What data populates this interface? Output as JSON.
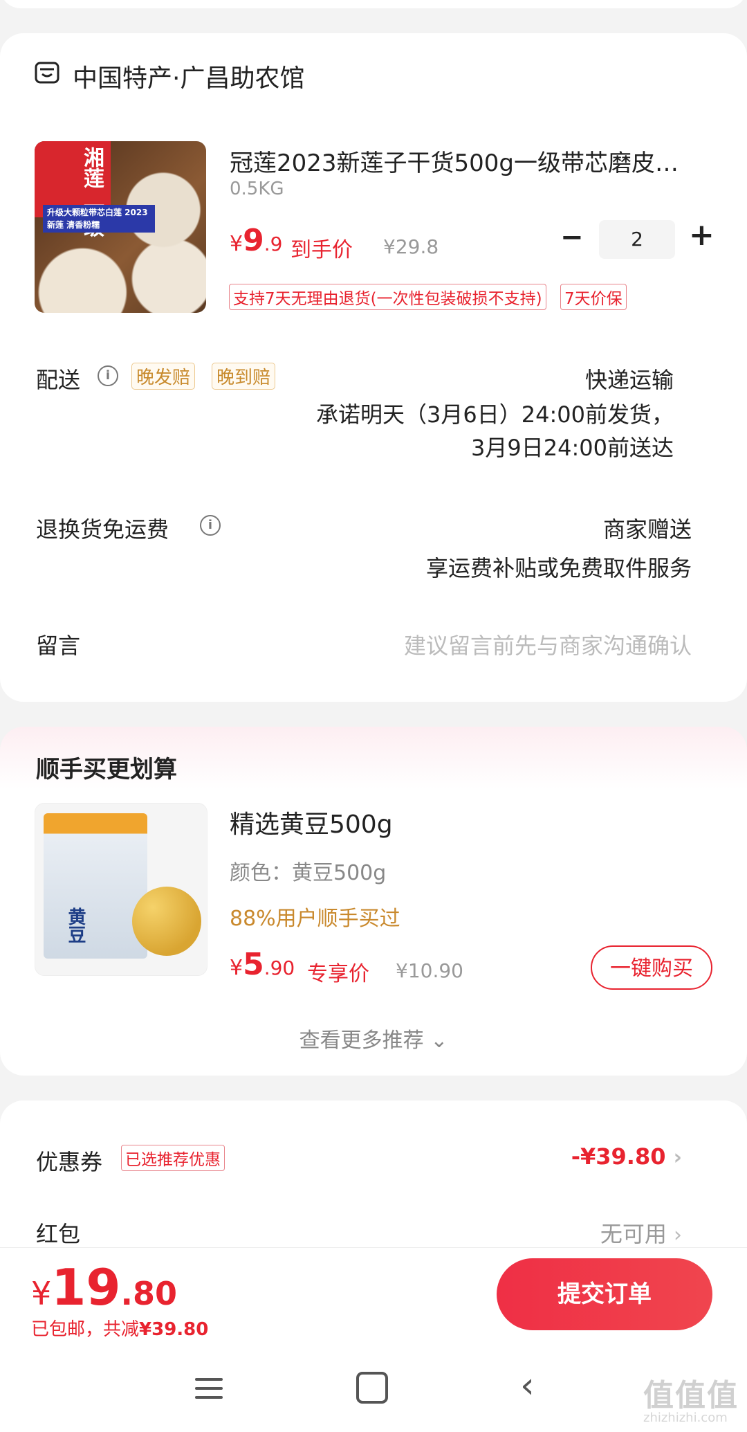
{
  "store": {
    "name": "中国特产·广昌助农馆"
  },
  "product": {
    "name": "冠莲2023新莲子干货500g一级带芯磨皮…",
    "spec": "0.5KG",
    "price_currency": "¥",
    "price_int": "9",
    "price_dec": ".9",
    "price_label": "到手价",
    "original_price": "¥29.8",
    "quantity": "2",
    "image_badge": "湘莲 一级",
    "image_band": "升级大颗粒带芯白莲 2023新莲 清香粉糯",
    "tags": [
      "支持7天无理由退货(一次性包装破损不支持)",
      "7天价保"
    ]
  },
  "delivery": {
    "label": "配送",
    "tags": [
      "晚发赔",
      "晚到赔"
    ],
    "method": "快递运输",
    "promise_line1": "承诺明天（3月6日）24:00前发货，",
    "promise_line2": "3月9日24:00前送达"
  },
  "return_shipping": {
    "label": "退换货免运费",
    "value": "商家赠送",
    "desc": "享运费补贴或免费取件服务"
  },
  "message": {
    "label": "留言",
    "placeholder": "建议留言前先与商家沟通确认"
  },
  "recommend": {
    "title": "顺手买更划算",
    "item": {
      "name": "精选黄豆500g",
      "spec": "颜色：黄豆500g",
      "buyers": "88%用户顺手买过",
      "price_currency": "¥",
      "price_int": "5",
      "price_dec": ".90",
      "price_label": "专享价",
      "original_price": "¥10.90",
      "buy_label": "一键购买",
      "image_text": "黄豆"
    },
    "more_label": "查看更多推荐"
  },
  "coupon": {
    "label": "优惠券",
    "tag": "已选推荐优惠",
    "value": "-¥39.80"
  },
  "red_packet": {
    "label": "红包",
    "value": "无可用"
  },
  "footer": {
    "currency": "¥",
    "total_int": "19",
    "total_dec": ".80",
    "shipping_note": "已包邮，共减",
    "discount": "¥39.80",
    "submit_label": "提交订单"
  },
  "watermark": {
    "text": "值值值",
    "sub": "zhizhizhi.com"
  },
  "colors": {
    "accent": "#e8232f",
    "gold": "#c9892d"
  }
}
